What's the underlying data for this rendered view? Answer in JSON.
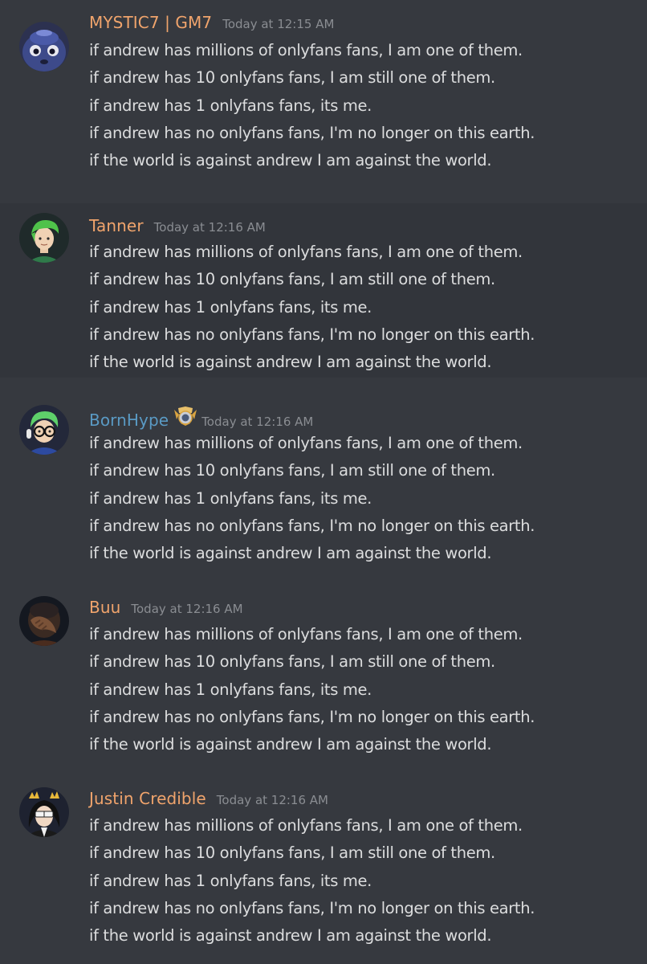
{
  "messages": [
    {
      "username": "MYSTIC7 | GM7",
      "timestamp": "Today at 12:15 AM",
      "avatar_icon": "blue-creature-avatar",
      "username_color": "#f0a46c",
      "lines": [
        "if andrew has millions of onlyfans fans, I am one of them.",
        "if andrew has 10 onlyfans fans, I am still one of them.",
        "if andrew has 1 onlyfans fans, its me.",
        "if andrew has no onlyfans fans, I'm no longer on this earth.",
        "if the world is against andrew I am against the world."
      ]
    },
    {
      "username": "Tanner",
      "timestamp": "Today at 12:16 AM",
      "avatar_icon": "green-haired-avatar",
      "username_color": "#f0a46c",
      "lines": [
        "if andrew has millions of onlyfans fans, I am one of them.",
        "if andrew has 10 onlyfans fans, I am still one of them.",
        "if andrew has 1 onlyfans fans, its me.",
        "if andrew has no onlyfans fans, I'm no longer on this earth.",
        "if the world is against andrew I am against the world."
      ]
    },
    {
      "username": "BornHype",
      "timestamp": "Today at 12:16 AM",
      "avatar_icon": "glasses-avatar",
      "badge_icon": "champion-crest-icon",
      "username_color": "#5a9ac4",
      "lines": [
        "if andrew has millions of onlyfans fans, I am one of them.",
        "if andrew has 10 onlyfans fans, I am still one of them.",
        "if andrew has 1 onlyfans fans, its me.",
        "if andrew has no onlyfans fans, I'm no longer on this earth.",
        "if the world is against andrew I am against the world."
      ]
    },
    {
      "username": "Buu",
      "timestamp": "Today at 12:16 AM",
      "avatar_icon": "facepalm-photo-avatar",
      "username_color": "#f0a46c",
      "lines": [
        "if andrew has millions of onlyfans fans, I am one of them.",
        "if andrew has 10 onlyfans fans, I am still one of them.",
        "if andrew has 1 onlyfans fans, its me.",
        "if andrew has no onlyfans fans, I'm no longer on this earth.",
        "if the world is against andrew I am against the world."
      ]
    },
    {
      "username": "Justin Credible",
      "timestamp": "Today at 12:16 AM",
      "avatar_icon": "crowned-sunglasses-avatar",
      "username_color": "#f0a46c",
      "lines": [
        "if andrew has millions of onlyfans fans, I am one of them.",
        "if andrew has 10 onlyfans fans, I am still one of them.",
        "if andrew has 1 onlyfans fans, its me.",
        "if andrew has no onlyfans fans, I'm no longer on this earth.",
        "if the world is against andrew I am against the world."
      ]
    }
  ]
}
